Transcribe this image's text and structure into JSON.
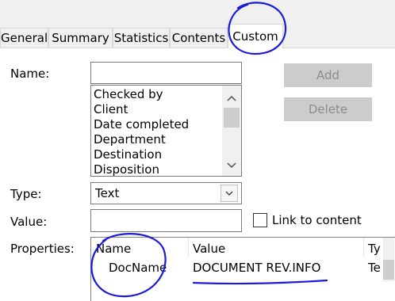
{
  "tabs": [
    "General",
    "Summary",
    "Statistics",
    "Contents",
    "Custom"
  ],
  "active_tab": "Custom",
  "name_label": "Name:",
  "name_value": "",
  "add_label": "Add",
  "delete_label": "Delete",
  "name_list": [
    "Checked by",
    "Client",
    "Date completed",
    "Department",
    "Destination",
    "Disposition"
  ],
  "type_label": "Type:",
  "type_value": "Text",
  "value_label": "Value:",
  "value_value": "",
  "link_label": "Link to content",
  "properties_label": "Properties:",
  "properties_columns": [
    "Name",
    "Value",
    "Ty"
  ],
  "properties_rows": [
    {
      "name": "DocName",
      "value": "DOCUMENT REV.INFO",
      "type": "Te"
    }
  ],
  "annotation_color": "#1a1adb"
}
